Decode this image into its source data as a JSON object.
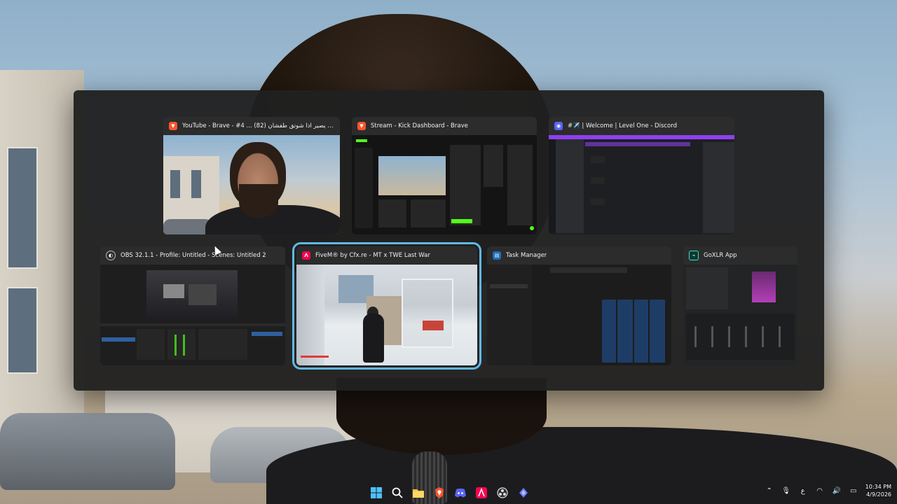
{
  "switcher": {
    "windows": [
      {
        "title": "YouTube - Brave - #4 ... هذا الي يصير اذا شوتق طفشان (82)",
        "app": "Brave",
        "icon": "brave-icon",
        "selected": false
      },
      {
        "title": "Stream - Kick Dashboard - Brave",
        "app": "Brave",
        "icon": "brave-icon",
        "selected": false
      },
      {
        "title": "#✈️ | Welcome | Level One - Discord",
        "app": "Discord",
        "icon": "discord-icon",
        "selected": false
      },
      {
        "title": "OBS 32.1.1 - Profile: Untitled - Scenes: Untitled 2",
        "app": "OBS",
        "icon": "obs-icon",
        "selected": false
      },
      {
        "title": "FiveM® by Cfx.re - MT x TWE Last War",
        "app": "FiveM",
        "icon": "fivem-icon",
        "selected": true
      },
      {
        "title": "Task Manager",
        "app": "Task Manager",
        "icon": "task-manager-icon",
        "selected": false
      },
      {
        "title": "GoXLR App",
        "app": "GoXLR",
        "icon": "goxlr-icon",
        "selected": false
      }
    ]
  },
  "taskbar": {
    "apps": [
      "windows-start-icon",
      "search-icon",
      "file-explorer-icon",
      "brave-icon",
      "discord-icon",
      "fivem-icon",
      "obs-icon",
      "kick-app-icon"
    ],
    "tray": {
      "language": "ع",
      "time": "10:34 PM",
      "date": "4/9/2026"
    }
  },
  "colors": {
    "selection_outline": "#62b8e6",
    "switcher_bg": "#202020",
    "brave": "#fb542b",
    "discord": "#5865f2",
    "kick": "#53fc18",
    "fivem": "#f40552"
  }
}
